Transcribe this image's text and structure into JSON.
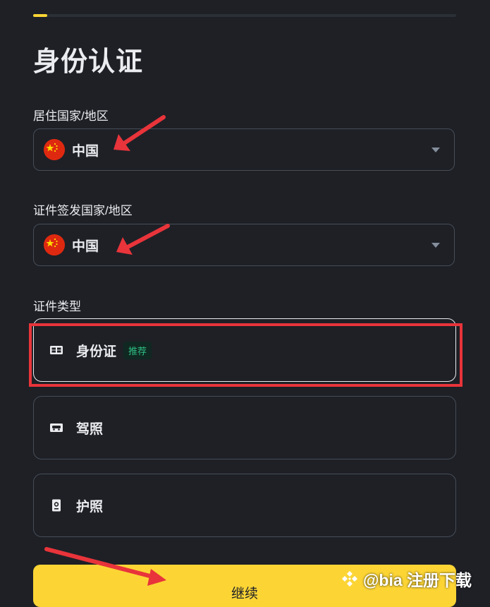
{
  "progress": {
    "value": 0.033
  },
  "page": {
    "title": "身份认证"
  },
  "residence": {
    "label": "居住国家/地区",
    "value": "中国",
    "flag_icon": "china-flag-icon"
  },
  "issuing": {
    "label": "证件签发国家/地区",
    "value": "中国",
    "flag_icon": "china-flag-icon"
  },
  "doc_type": {
    "label": "证件类型",
    "options": [
      {
        "label": "身份证",
        "tag": "推荐",
        "icon": "id-card-icon",
        "selected": true
      },
      {
        "label": "驾照",
        "icon": "driver-license-icon",
        "selected": false
      },
      {
        "label": "护照",
        "icon": "passport-icon",
        "selected": false
      }
    ]
  },
  "actions": {
    "continue_label": "继续"
  },
  "watermark": {
    "text": "@bia 注册下载",
    "logo_icon": "binance-logo-icon"
  },
  "colors": {
    "background": "#1e2026",
    "accent": "#fcd535",
    "annotation": "#e8343a",
    "tag_text": "#2ebd85",
    "tag_bg": "#102821",
    "border": "#474d57"
  }
}
